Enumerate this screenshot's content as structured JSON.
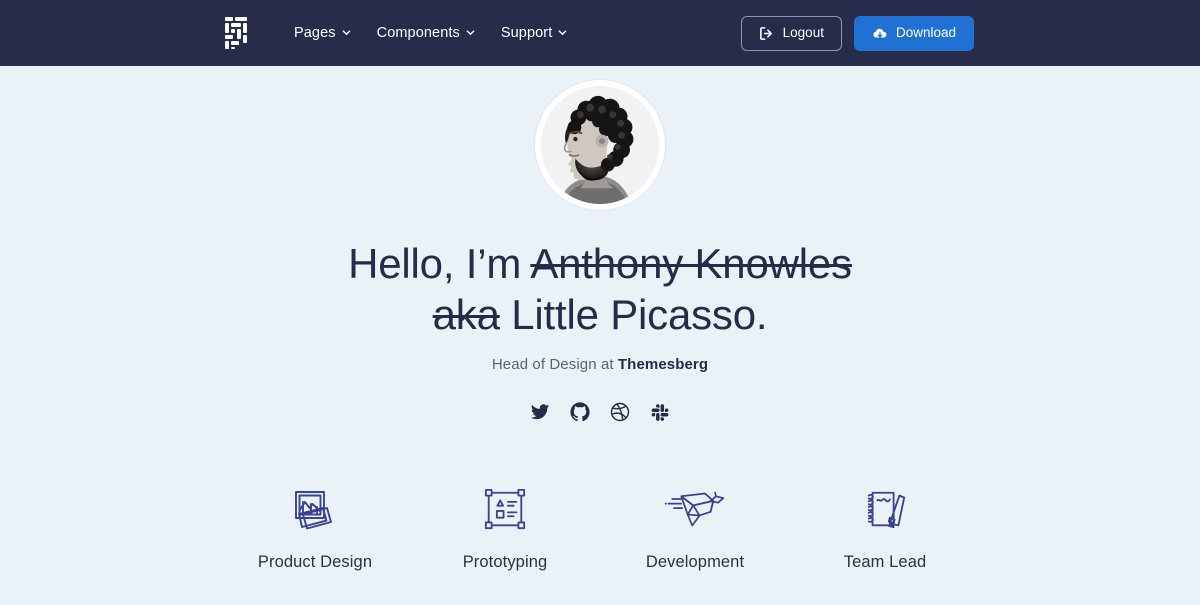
{
  "colors": {
    "navbar_bg": "#262c4a",
    "page_bg": "#eaf1f7",
    "primary_blue": "#2170d4",
    "heading": "#262c47",
    "icon_indigo": "#3b438f"
  },
  "navbar": {
    "brand_name": "themesberg-logo",
    "links": [
      {
        "label": "Pages",
        "icon": "chevron-down-icon"
      },
      {
        "label": "Components",
        "icon": "chevron-down-icon"
      },
      {
        "label": "Support",
        "icon": "chevron-down-icon"
      }
    ],
    "logout_button": {
      "label": "Logout",
      "icon": "sign-out-icon"
    },
    "download_button": {
      "label": "Download",
      "icon": "cloud-download-icon"
    }
  },
  "hero": {
    "avatar_alt": "portrait-photo",
    "headline": {
      "greeting": "Hello, I’m ",
      "struck_name": "Anthony Knowles",
      "struck_aka": "aka",
      "alias": " Little Picasso."
    },
    "subtitle": {
      "prefix": "Head of Design at ",
      "company": "Themesberg"
    },
    "socials": [
      {
        "name": "twitter-icon",
        "label": "Twitter"
      },
      {
        "name": "github-icon",
        "label": "GitHub"
      },
      {
        "name": "dribbble-icon",
        "label": "Dribbble"
      },
      {
        "name": "slack-icon",
        "label": "Slack"
      }
    ]
  },
  "features": [
    {
      "label": "Product Design",
      "icon": "photos-stack-icon"
    },
    {
      "label": "Prototyping",
      "icon": "artboard-shapes-icon"
    },
    {
      "label": "Development",
      "icon": "origami-bird-icon"
    },
    {
      "label": "Team Lead",
      "icon": "notepad-pencil-icon"
    }
  ]
}
